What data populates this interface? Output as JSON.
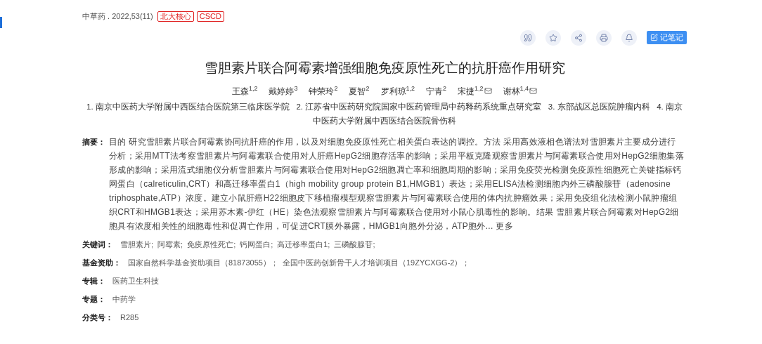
{
  "source": {
    "journal": "中草药 . 2022,53(11)",
    "tags": [
      "北大核心",
      "CSCD"
    ]
  },
  "tools": [
    {
      "kind": "quote"
    },
    {
      "kind": "star"
    },
    {
      "kind": "share"
    },
    {
      "kind": "print"
    },
    {
      "kind": "bell"
    }
  ],
  "note_button": "记笔记",
  "title": "雪胆素片联合阿霉素增强细胞免疫原性死亡的抗肝癌作用研究",
  "authors": [
    {
      "name": "王森",
      "sup": "1,2",
      "email": false
    },
    {
      "name": "戴婷婷",
      "sup": "3",
      "email": false
    },
    {
      "name": "钟荣玲",
      "sup": "2",
      "email": false
    },
    {
      "name": "夏智",
      "sup": "2",
      "email": false
    },
    {
      "name": "罗利琼",
      "sup": "1,2",
      "email": false
    },
    {
      "name": "宁青",
      "sup": "2",
      "email": false
    },
    {
      "name": "宋捷",
      "sup": "1,2",
      "email": true
    },
    {
      "name": "谢林",
      "sup": "1,4",
      "email": true
    }
  ],
  "affiliations": [
    "1. 南京中医药大学附属中西医结合医院第三临床医学院",
    "2. 江苏省中医药研究院国家中医药管理局中药释药系统重点研究室",
    "3. 东部战区总医院肿瘤内科",
    "4. 南京中医药大学附属中西医结合医院骨伤科"
  ],
  "abstract": {
    "label": "摘要：",
    "text": "目的 研究雪胆素片联合阿霉素协同抗肝癌的作用，以及对细胞免疫原性死亡相关蛋白表达的调控。方法 采用高效液相色谱法对雪胆素片主要成分进行分析；采用MTT法考察雪胆素片与阿霉素联合使用对人肝癌HepG2细胞存活率的影响；采用平板克隆观察雪胆素片与阿霉素联合使用对HepG2细胞集落形成的影响；采用流式细胞仪分析雪胆素片与阿霉素联合使用对HepG2细胞凋亡率和细胞周期的影响；采用免疫荧光检测免疫原性细胞死亡关键指标钙网蛋白（calreticulin,CRT）和高迁移率蛋白1（high mobility group protein B1,HMGB1）表达；采用ELISA法检测细胞内外三磷酸腺苷（adenosine triphosphate,ATP）浓度。建立小鼠肝癌H22细胞皮下移植瘤模型观察雪胆素片与阿霉素联合使用的体内抗肿瘤效果；采用免疫组化法检测小鼠肿瘤组织CRT和HMGB1表达；采用苏木素-伊红（HE）染色法观察雪胆素片与阿霉素联合使用对小鼠心肌毒性的影响。结果 雪胆素片联合阿霉素对HepG2细胞具有浓度相关性的细胞毒性和促凋亡作用，可促进CRT膜外暴露，HMGB1向胞外分泌，ATP胞外...",
    "more": "更多"
  },
  "fields": [
    {
      "label": "关键词：",
      "values": [
        "雪胆素片;",
        "阿霉素;",
        "免疫原性死亡;",
        "钙网蛋白;",
        "高迁移率蛋白1;",
        "三磷酸腺苷;"
      ]
    },
    {
      "label": "基金资助：",
      "values": [
        "国家自然科学基金资助项目（81873055）；",
        "全国中医药创新骨干人才培训项目（19ZYCXGG-2）；"
      ]
    },
    {
      "label": "专辑：",
      "values": [
        "医药卫生科技"
      ]
    },
    {
      "label": "专题：",
      "values": [
        "中药学"
      ]
    },
    {
      "label": "分类号：",
      "values": [
        "R285"
      ]
    }
  ]
}
